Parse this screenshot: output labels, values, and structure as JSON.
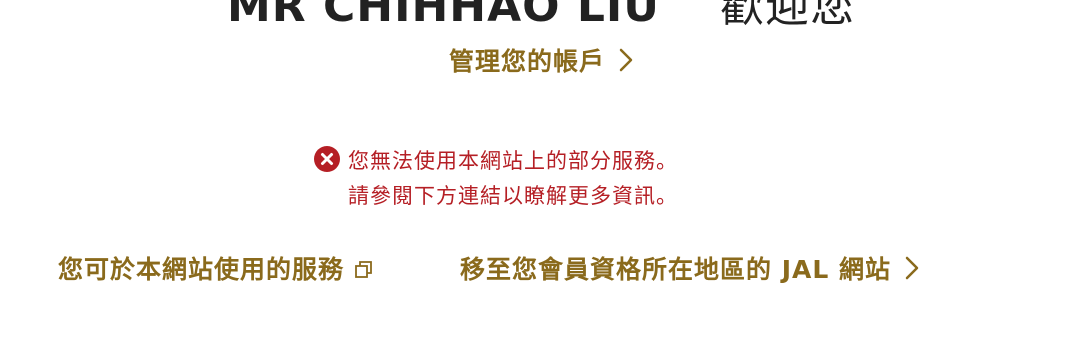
{
  "header": {
    "greeting_name": "MR CHIHHAO LIU",
    "welcome_text": "歡迎您"
  },
  "account": {
    "manage_label": "管理您的帳戶",
    "chevron_icon": "chevron-right-icon"
  },
  "alert": {
    "icon": "error-circle-icon",
    "line1": "您無法使用本網站上的部分服務。",
    "line2": "請參閱下方連結以瞭解更多資訊。",
    "color": "#b51f25"
  },
  "links": {
    "available_services": {
      "label": "您可於本網站使用的服務",
      "icon": "external-window-icon"
    },
    "region_site": {
      "label": "移至您會員資格所在地區的 JAL 網站",
      "icon": "chevron-right-icon"
    }
  },
  "colors": {
    "accent": "#8a6a1c",
    "error": "#b51f25",
    "text": "#222222"
  }
}
